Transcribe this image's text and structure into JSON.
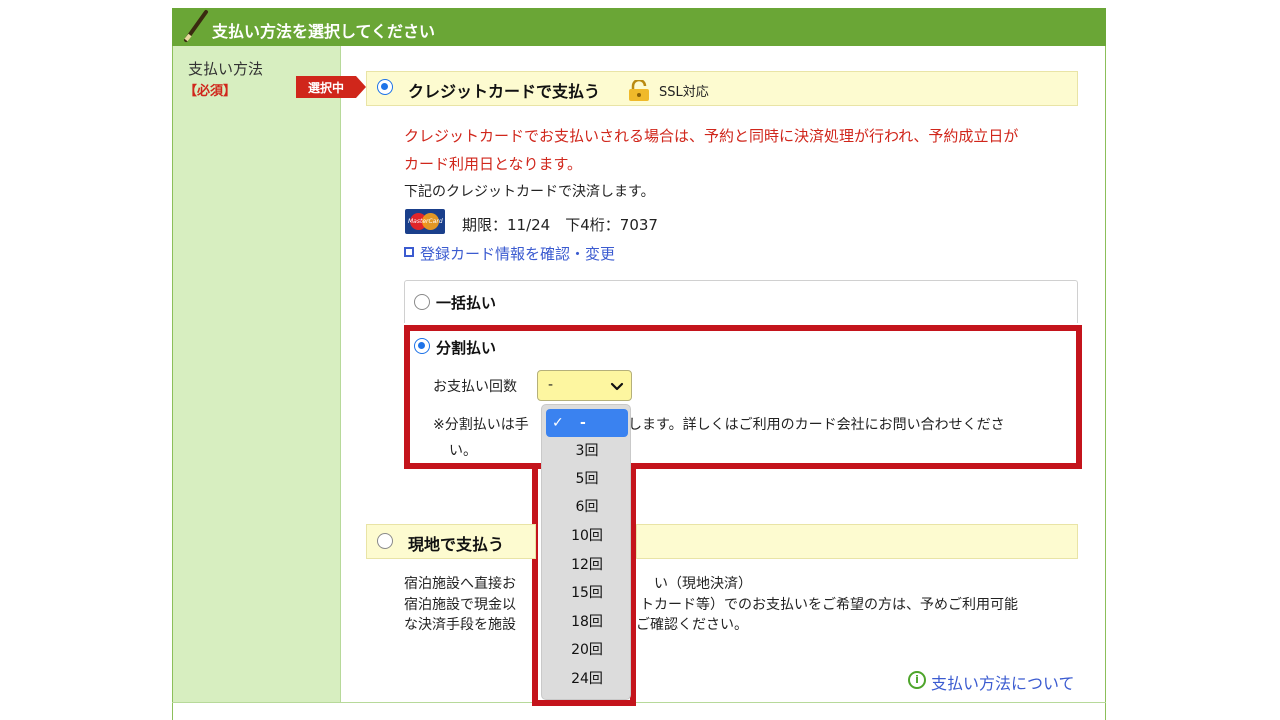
{
  "header": {
    "title": "支払い方法を選択してください"
  },
  "left": {
    "label": "支払い方法",
    "required": "【必須】"
  },
  "selected_tag": "選択中",
  "credit": {
    "label": "クレジットカードで支払う",
    "ssl": "SSL対応",
    "notice_line1": "クレジットカードでお支払いされる場合は、予約と同時に決済処理が行われ、予約成立日が",
    "notice_line2": "カード利用日となります。",
    "settle_text": "下記のクレジットカードで決済します。",
    "card_info": "期限：11/24　下4桁：7037",
    "change_link": "登録カード情報を確認・変更"
  },
  "installments": {
    "lump_sum": "一括払い",
    "split": "分割払い",
    "count_label": "お支払い回数",
    "selected_value": "-",
    "note_start": "※分割払いは手",
    "note_end": "します。詳しくはご利用のカード会社にお問い合わせくださ",
    "note_tail": "い。",
    "options": [
      "-",
      "3回",
      "5回",
      "6回",
      "10回",
      "12回",
      "15回",
      "18回",
      "20回",
      "24回"
    ]
  },
  "onsite": {
    "label": "現地で支払う",
    "line1_a": "宿泊施設へ直接お",
    "line1_b": "い（現地決済）",
    "line2_a": "宿泊施設で現金以",
    "line2_b": "トカード等）でのお支払いをご希望の方は、予めご利用可能",
    "line3_a": "な決済手段を施設",
    "line3_b": "ご確認ください。"
  },
  "about_link": "支払い方法について",
  "colors": {
    "header_green": "#6aa636",
    "left_col": "#d7eec0",
    "alert_red": "#d0261b",
    "highlight_red": "#c4141c",
    "link_blue": "#3b5bd0",
    "select_blue": "#3a82f0"
  }
}
